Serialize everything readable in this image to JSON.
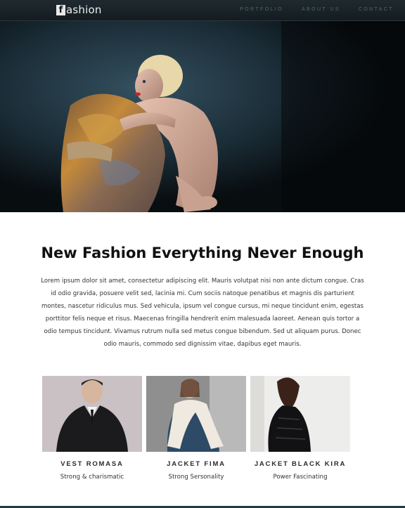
{
  "nav": {
    "logo_letter": "f",
    "logo_text": "ashion",
    "links": [
      "PORTFOLIO",
      "ABOUT US",
      "CONTACT"
    ]
  },
  "hero": {
    "image": "fashion-model-photo"
  },
  "intro": {
    "title": "New Fashion Everything Never Enough",
    "text": "Lorem ipsum dolor sit amet, consectetur adipiscing elit. Mauris volutpat nisi non ante dictum congue. Cras id odio gravida, posuere velit sed, lacinia mi. Cum sociis natoque penatibus et magnis dis parturient montes, nascetur ridiculus mus. Sed vehicula, ipsum vel congue cursus, mi neque tincidunt enim, egestas porttitor felis neque et risus. Maecenas fringilla hendrerit enim malesuada laoreet. Aenean quis tortor a odio tempus tincidunt. Vivamus rutrum nulla sed metus congue bibendum. Sed ut aliquam purus. Donec odio mauris, commodo sed dignissim vitae, dapibus eget mauris."
  },
  "products": [
    {
      "name": "VEST ROMASA",
      "desc": "Strong & charismatic"
    },
    {
      "name": "JACKET FIMA",
      "desc": "Strong Sersonality"
    },
    {
      "name": "JACKET BLACK KIRA",
      "desc": "Power Fascinating"
    }
  ],
  "colors": {
    "nav_bg": "#18242a",
    "nav_link": "#4e6873",
    "title": "#111111",
    "bottom_bar": "#1e3a44"
  }
}
